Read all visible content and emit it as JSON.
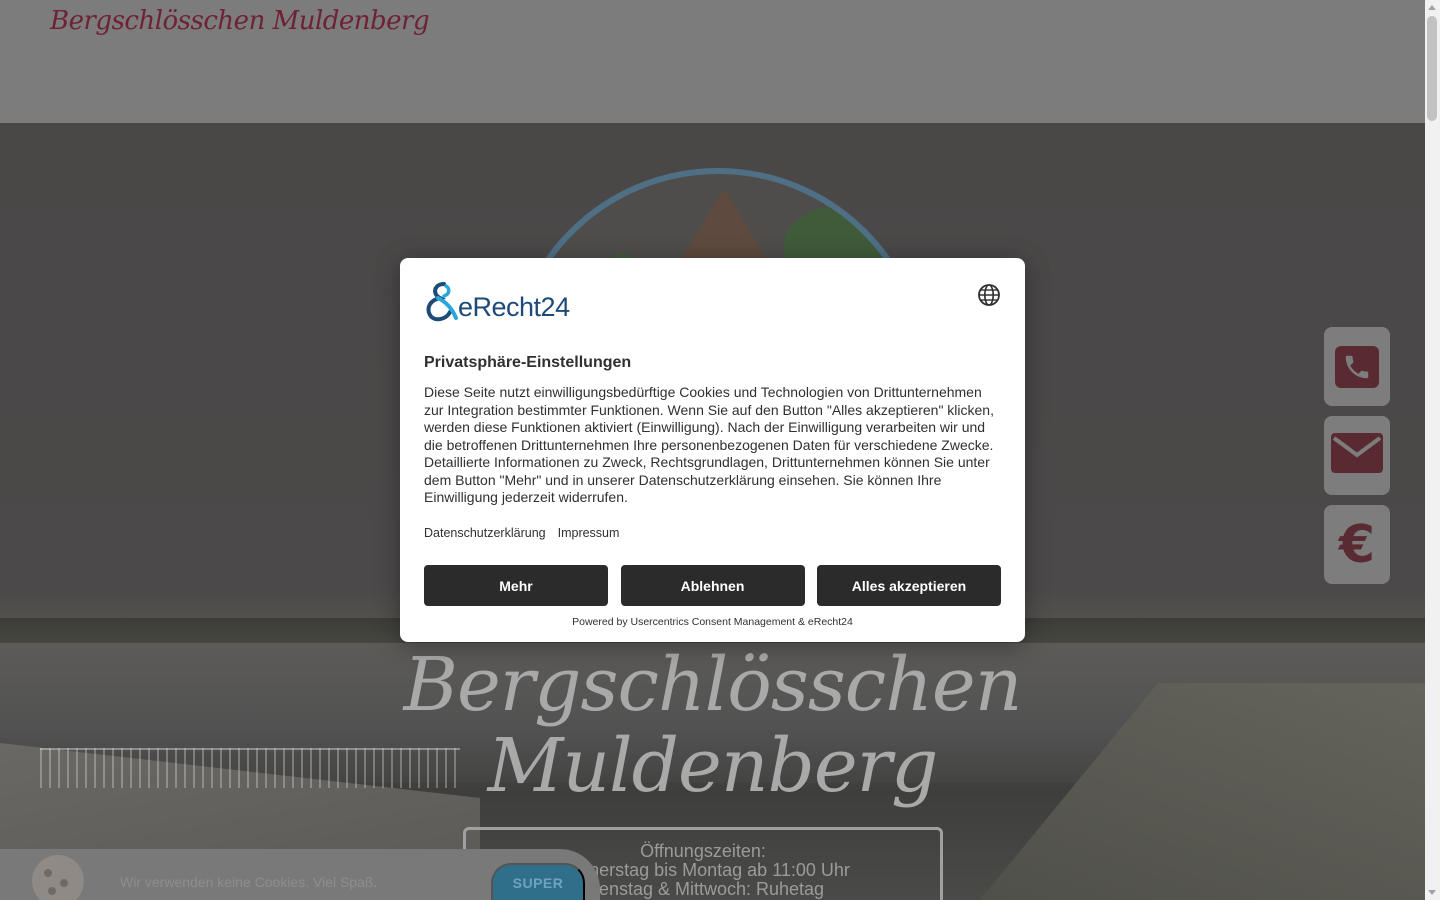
{
  "header": {
    "logo_text": "Bergschlösschen Muldenberg"
  },
  "hero": {
    "title_line1": "Bergschlösschen",
    "title_line2": "Muldenberg",
    "hours_heading": "Öffnungszeiten:",
    "hours_line1": "Donnerstag bis Montag ab 11:00 Uhr",
    "hours_line2": "Dienstag & Mittwoch: Ruhetag"
  },
  "side_buttons": [
    {
      "icon": "phone-icon"
    },
    {
      "icon": "mail-icon"
    },
    {
      "icon": "euro-icon",
      "glyph": "€"
    }
  ],
  "cookie_bar": {
    "text": "Wir verwenden keine Cookies. Viel Spaß.",
    "button_label": "SUPER"
  },
  "consent": {
    "brand_name": "eRecht24",
    "title": "Privatsphäre-Einstellungen",
    "body": "Diese Seite nutzt einwilligungsbedürftige Cookies und Technologien von Drittunternehmen zur Integration bestimmter Funktionen. Wenn Sie auf den Button \"Alles akzeptieren\" klicken, werden diese Funktionen aktiviert (Einwilligung). Nach der Einwilligung verarbeiten wir und die betroffenen Drittunternehmen Ihre personenbezogenen Daten für verschiedene Zwecke. Detaillierte Informationen zu Zweck, Rechtsgrundlagen, Drittunternehmen können Sie unter dem Button \"Mehr\" und in unserer Datenschutzerklärung einsehen. Sie können Ihre Einwilligung jederzeit widerrufen.",
    "links": [
      "Datenschutzerklärung",
      "Impressum"
    ],
    "buttons": {
      "more": "Mehr",
      "deny": "Ablehnen",
      "accept_all": "Alles akzeptieren"
    },
    "powered_by": "Powered by Usercentrics Consent Management & eRecht24",
    "colors": {
      "brand_blue": "#1d4a78",
      "brand_cyan": "#2aa7d9",
      "button_dark": "#2b2b2b"
    }
  },
  "colors": {
    "logo_wine": "#6e2236",
    "overlay": "#7a7a7a"
  }
}
